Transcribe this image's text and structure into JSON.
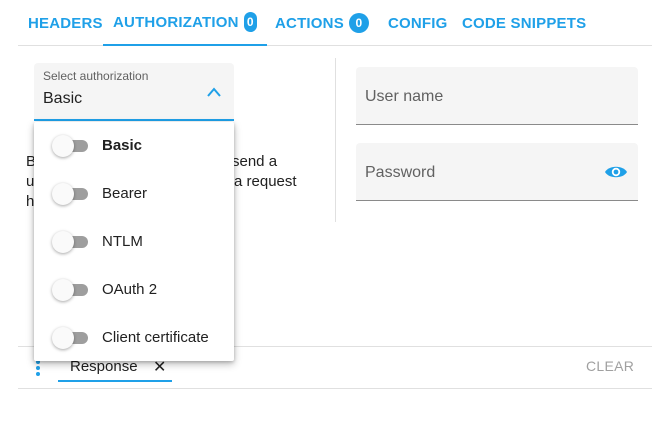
{
  "tabs": [
    {
      "label": "HEADERS",
      "active": false
    },
    {
      "label": "AUTHORIZATION",
      "badge": "0",
      "active": true
    },
    {
      "label": "ACTIONS",
      "badge": "0",
      "active": false
    },
    {
      "label": "CONFIG",
      "active": false
    },
    {
      "label": "CODE SNIPPETS",
      "active": false
    }
  ],
  "auth_select": {
    "label": "Select authorization",
    "value": "Basic",
    "chevron_icon": "chevron-up-icon"
  },
  "description": {
    "line1_start": "B",
    "line1_end": "send a",
    "line2_start": "u",
    "line2_end": "a request",
    "line3_start": "h"
  },
  "dropdown": {
    "options": [
      {
        "label": "Basic",
        "selected": true
      },
      {
        "label": "Bearer",
        "selected": false
      },
      {
        "label": "NTLM",
        "selected": false
      },
      {
        "label": "OAuth 2",
        "selected": false
      },
      {
        "label": "Client certificate",
        "selected": false
      }
    ]
  },
  "fields": {
    "username_placeholder": "User name",
    "password_placeholder": "Password",
    "password_visibility_icon": "eye-icon"
  },
  "bottom": {
    "menu_icon": "kebab-menu-icon",
    "response_tab": "Response",
    "close_glyph": "✕",
    "clear_label": "CLEAR"
  },
  "colors": {
    "accent": "#1fa0e8",
    "field_bg": "#f5f5f5",
    "muted_text": "#a0a0a0"
  }
}
